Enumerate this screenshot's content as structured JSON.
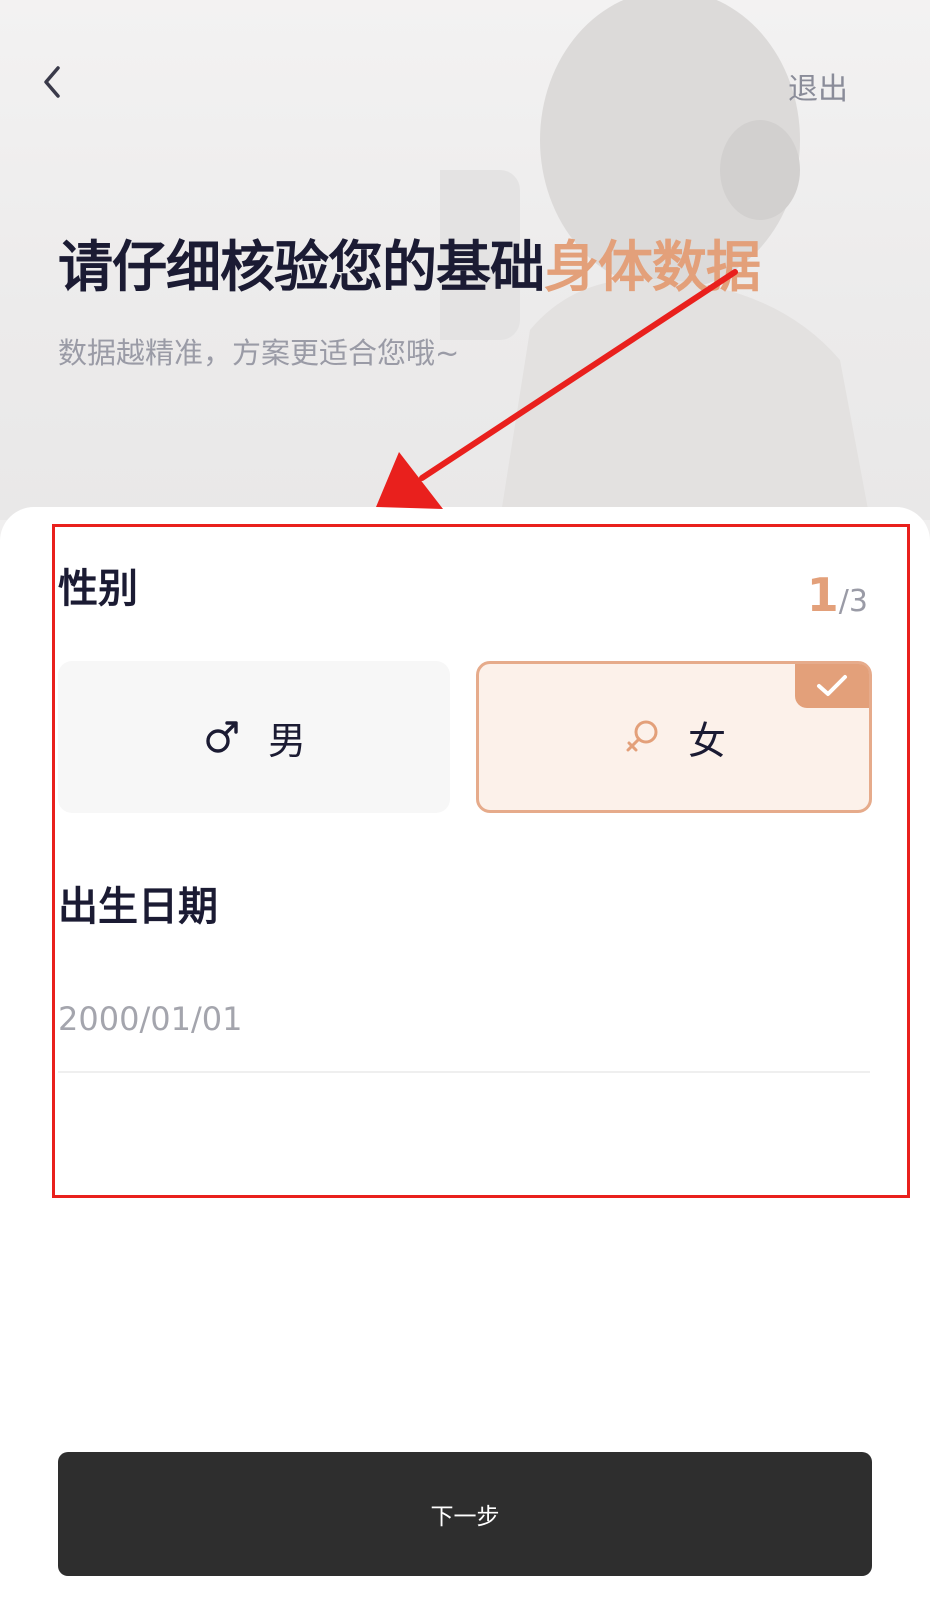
{
  "header": {
    "back_icon": "chevron-left-icon",
    "exit_label": "退出"
  },
  "hero": {
    "title_main": "请仔细核验您的基础",
    "title_accent": "身体数据",
    "subtitle": "数据越精准，方案更适合您哦~"
  },
  "gender": {
    "title": "性别",
    "step_current": "1",
    "step_total": "/3",
    "options": [
      {
        "label": "男",
        "icon": "male-icon",
        "selected": false
      },
      {
        "label": "女",
        "icon": "female-icon",
        "selected": true
      }
    ]
  },
  "birth": {
    "title": "出生日期",
    "value": "2000/01/01"
  },
  "footer": {
    "next_label": "下一步"
  },
  "colors": {
    "accent": "#e3a07a",
    "dark": "#1b1b33",
    "annotation": "#e9201d",
    "button": "#2e2e2e"
  }
}
